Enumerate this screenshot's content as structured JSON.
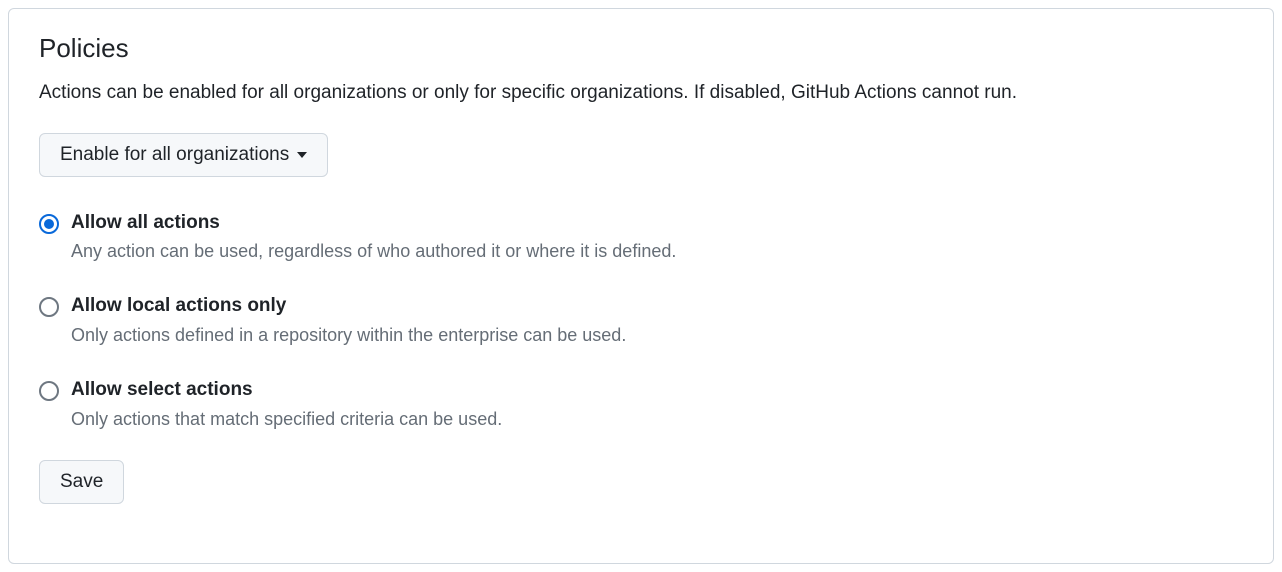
{
  "heading": "Policies",
  "description": "Actions can be enabled for all organizations or only for specific organizations. If disabled, GitHub Actions cannot run.",
  "dropdown": {
    "label": "Enable for all organizations"
  },
  "radios": {
    "selected": 0,
    "options": [
      {
        "title": "Allow all actions",
        "description": "Any action can be used, regardless of who authored it or where it is defined."
      },
      {
        "title": "Allow local actions only",
        "description": "Only actions defined in a repository within the enterprise can be used."
      },
      {
        "title": "Allow select actions",
        "description": "Only actions that match specified criteria can be used."
      }
    ]
  },
  "save_label": "Save"
}
